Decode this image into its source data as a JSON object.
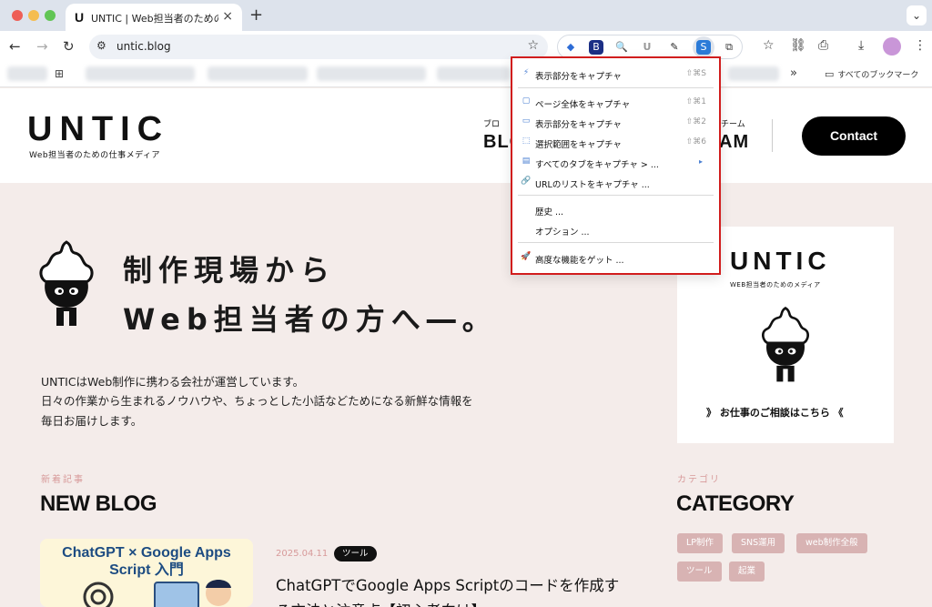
{
  "browser": {
    "tab_title": "UNTIC | Web担当者のための仕事",
    "tab_favicon": "U",
    "url": "untic.blog",
    "all_bookmarks_label": "すべてのブックマーク"
  },
  "site": {
    "logo": "UNTIC",
    "logo_sub": "Web担当者のための仕事メディア",
    "nav_left_small": "ブロ",
    "nav_left_big": "BLO",
    "nav_right_small": "チーム",
    "nav_right_big": "AM",
    "contact": "Contact"
  },
  "hero": {
    "line1": "制作現場から",
    "line2": "Web担当者の方へ―。",
    "intro": [
      "UNTICはWeb制作に携わる会社が運営しています。",
      "日々の作業から生まれるノウハウや、ちょっとした小話などためになる新鮮な情報を",
      "毎日お届けします。"
    ]
  },
  "side_card": {
    "logo": "UNTIC",
    "sub": "WEB担当者のためのメディア",
    "cta": "》 お仕事のご相談はこちら 《"
  },
  "new_blog": {
    "kicker": "新着記事",
    "title": "NEW BLOG",
    "thumb_title": "ChatGPT × Google Apps Script 入門",
    "date": "2025.04.11",
    "tag": "ツール",
    "post_title": "ChatGPTでGoogle Apps Scriptのコードを作成する方法と注意点【初心者向け】"
  },
  "category": {
    "kicker": "カテゴリ",
    "title": "CATEGORY",
    "chips": [
      "LP制作",
      "SNS運用",
      "web制作全般",
      "ツール",
      "起業"
    ]
  },
  "capture_menu": {
    "items": [
      {
        "icon": "⚡",
        "label": "表示部分をキャプチャ",
        "shortcut": "⇧⌘S"
      },
      {
        "icon": "▢",
        "label": "ページ全体をキャプチャ",
        "shortcut": "⇧⌘1"
      },
      {
        "icon": "▭",
        "label": "表示部分をキャプチャ",
        "shortcut": "⇧⌘2"
      },
      {
        "icon": "⬚",
        "label": "選択範囲をキャプチャ",
        "shortcut": "⇧⌘6"
      },
      {
        "icon": "▤",
        "label": "すべてのタブをキャプチャ > ...",
        "shortcut": "▸"
      },
      {
        "icon": "🔗",
        "label": "URLのリストをキャプチャ ...",
        "shortcut": ""
      },
      {
        "icon": "",
        "label": "歴史 ...",
        "shortcut": ""
      },
      {
        "icon": "",
        "label": "オプション ...",
        "shortcut": ""
      },
      {
        "icon": "🚀",
        "label": "高度な機能をゲット ...",
        "shortcut": ""
      }
    ],
    "highlight_color": "#d11d1d"
  }
}
